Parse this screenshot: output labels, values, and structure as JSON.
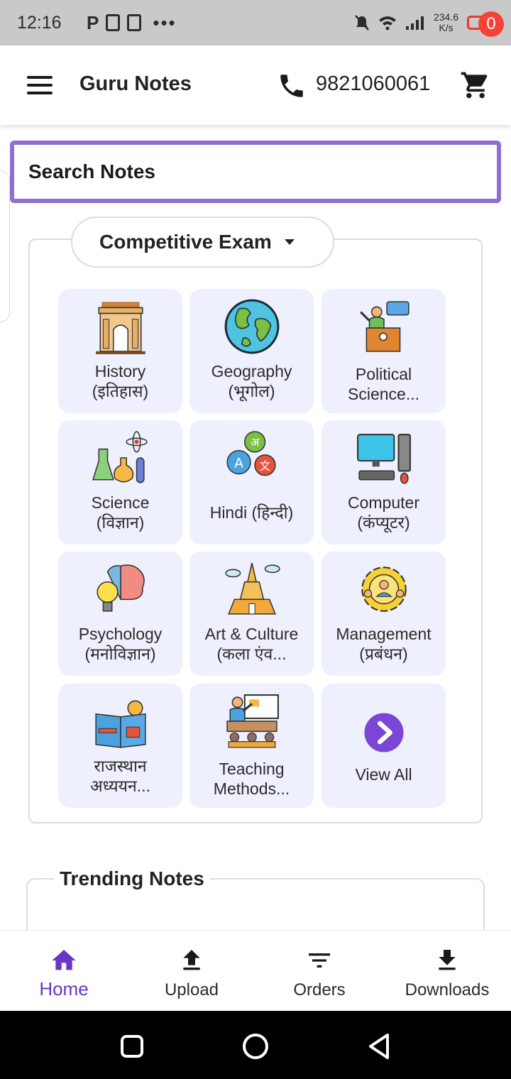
{
  "status_bar": {
    "time": "12:16",
    "speed_value": "234.6",
    "speed_unit": "K/s"
  },
  "app_bar": {
    "title": "Guru Notes",
    "phone": "9821060061",
    "cart_count": "0"
  },
  "search": {
    "placeholder": "Search Notes"
  },
  "exam_selector": {
    "label": "Competitive Exam"
  },
  "categories": [
    {
      "label": "History\n(इतिहास)",
      "icon": "india-gate-icon"
    },
    {
      "label": "Geography\n(भूगोल)",
      "icon": "globe-icon"
    },
    {
      "label": "Political\nScience...",
      "icon": "speaker-podium-icon"
    },
    {
      "label": "Science\n(विज्ञान)",
      "icon": "lab-flasks-icon"
    },
    {
      "label": "Hindi (हिन्दी)",
      "icon": "translate-bubbles-icon"
    },
    {
      "label": "Computer\n(कंप्यूटर)",
      "icon": "desktop-computer-icon"
    },
    {
      "label": "Psychology\n(मनोविज्ञान)",
      "icon": "brain-bulb-icon"
    },
    {
      "label": "Art & Culture\n(कला एंव...",
      "icon": "temple-icon"
    },
    {
      "label": "Management\n(प्रबंधन)",
      "icon": "team-gear-icon"
    },
    {
      "label": "राजस्थान\nअध्ययन...",
      "icon": "book-idea-icon"
    },
    {
      "label": "Teaching\nMethods...",
      "icon": "classroom-teacher-icon"
    },
    {
      "label": "View All",
      "icon": "chevron-right-circle-icon"
    }
  ],
  "trending": {
    "title": "Trending Notes"
  },
  "bottom_nav": [
    {
      "label": "Home",
      "icon": "home-icon",
      "active": true
    },
    {
      "label": "Upload",
      "icon": "upload-icon",
      "active": false
    },
    {
      "label": "Orders",
      "icon": "filter-list-icon",
      "active": false
    },
    {
      "label": "Downloads",
      "icon": "download-icon",
      "active": false
    }
  ],
  "colors": {
    "accent": "#6a35c9",
    "search_border": "#8e6fd1",
    "tile_bg": "#eef1fd",
    "badge": "#f44336"
  }
}
